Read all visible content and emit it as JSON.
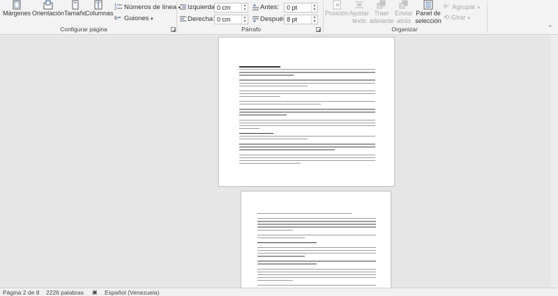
{
  "ribbon": {
    "configurar_pagina": {
      "group_label": "Configurar página",
      "margenes": "Márgenes",
      "orientacion": "Orientación",
      "tamano": "Tamaño",
      "columnas": "Columnas",
      "numeros_linea": "Números de línea",
      "guiones": "Guiones"
    },
    "parrafo": {
      "group_label": "Párrafo",
      "sangria_izquierda_label": "Izquierda:",
      "sangria_izquierda_value": "0 cm",
      "sangria_derecha_label": "Derecha:",
      "sangria_derecha_value": "0 cm",
      "antes_label": "Antes:",
      "antes_value": "0 pt",
      "despues_label": "Después:",
      "despues_value": "8 pt"
    },
    "organizar": {
      "group_label": "Organizar",
      "posicion_1": "Posición",
      "ajustar_1": "Ajustar",
      "ajustar_2": "texto",
      "traer_1": "Traer",
      "traer_2": "adelante",
      "enviar_1": "Enviar",
      "enviar_2": "atrás",
      "panel_1": "Panel de",
      "panel_2": "selección",
      "agrupar": "Agrupar",
      "girar": "Girar"
    }
  },
  "status": {
    "page": "Página 2 de 8",
    "words": "2226 palabras",
    "language": "Español (Venezuela)"
  },
  "colors": {
    "ribbon_bg": "#f3f3f3",
    "workspace_bg": "#e6e6e6",
    "icon_blue": "#2b579a"
  }
}
